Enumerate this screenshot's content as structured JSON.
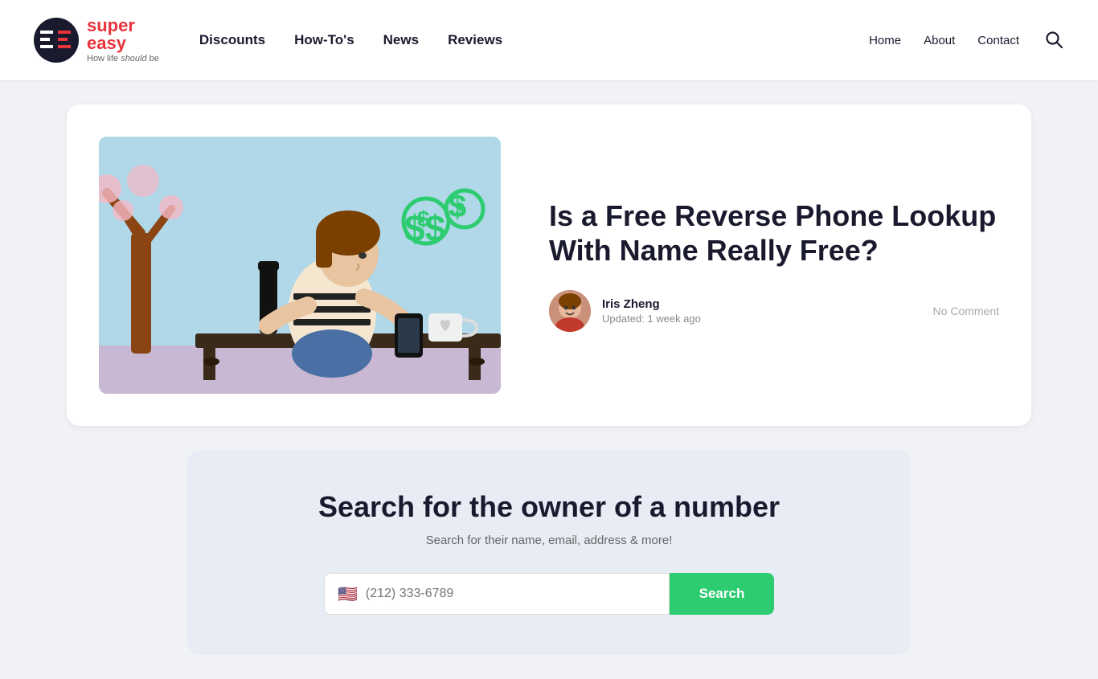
{
  "header": {
    "logo": {
      "brand1": "super",
      "brand2": "easy",
      "tagline_pre": "How life ",
      "tagline_em": "should",
      "tagline_post": " be"
    },
    "nav": {
      "items": [
        {
          "label": "Discounts",
          "href": "#"
        },
        {
          "label": "How-To's",
          "href": "#"
        },
        {
          "label": "News",
          "href": "#"
        },
        {
          "label": "Reviews",
          "href": "#"
        }
      ]
    },
    "right_nav": {
      "items": [
        {
          "label": "Home",
          "href": "#"
        },
        {
          "label": "About",
          "href": "#"
        },
        {
          "label": "Contact",
          "href": "#"
        }
      ]
    }
  },
  "article": {
    "title": "Is a Free Reverse Phone Lookup With Name Really Free?",
    "author": {
      "name": "Iris Zheng",
      "updated": "Updated: 1 week ago"
    },
    "no_comment": "No Comment"
  },
  "search_widget": {
    "title": "Search for the owner of a number",
    "subtitle": "Search for their name, email, address & more!",
    "input_placeholder": "(212) 333-6789",
    "button_label": "Search"
  }
}
